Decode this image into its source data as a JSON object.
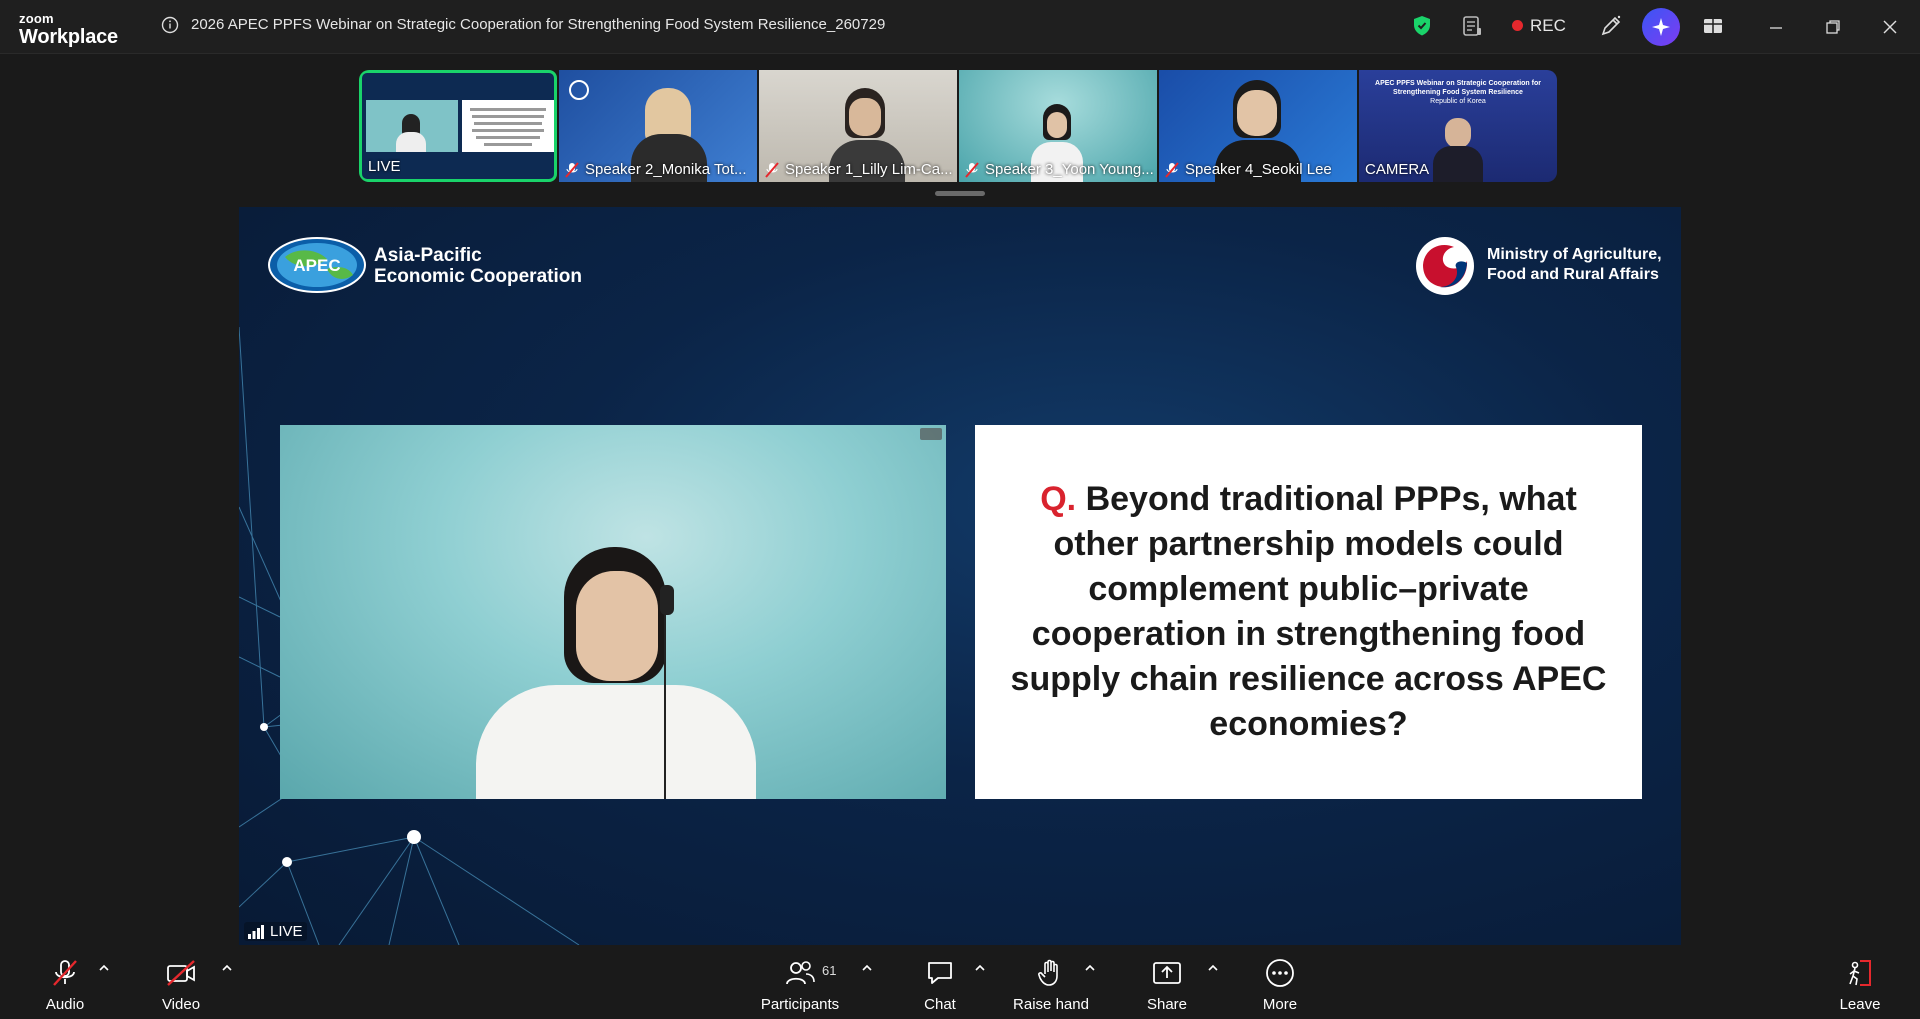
{
  "app": {
    "logo_line1": "zoom",
    "logo_line2": "Workplace",
    "meeting_title": "2026 APEC PPFS Webinar on Strategic Cooperation for Strengthening Food System Resilience_260729",
    "rec_label": "REC"
  },
  "strip": {
    "tiles": [
      {
        "label": "LIVE",
        "muted": false
      },
      {
        "label": "Speaker 2_Monika Tot...",
        "muted": true
      },
      {
        "label": "Speaker 1_Lilly Lim-Ca...",
        "muted": true
      },
      {
        "label": "Speaker 3_Yoon Young...",
        "muted": true
      },
      {
        "label": "Speaker 4_Seokil Lee",
        "muted": true
      },
      {
        "label": "CAMERA",
        "muted": false
      }
    ],
    "tile6_lines": [
      "APEC PPFS Webinar on Strategic Cooperation for",
      "Strengthening Food System Resilience",
      "Republic of Korea"
    ]
  },
  "share": {
    "apec_logo_text": "APEC",
    "apec_line1": "Asia-Pacific",
    "apec_line2": "Economic Cooperation",
    "mafra_line1": "Ministry of Agriculture,",
    "mafra_line2": "Food and Rural Affairs",
    "question_mark": "Q.",
    "question_text": " Beyond traditional PPPs, what other partnership models could complement public–private cooperation in strengthening food supply chain resilience across APEC economies?",
    "live_label": "LIVE"
  },
  "toolbar": {
    "audio": "Audio",
    "video": "Video",
    "participants": "Participants",
    "participants_count": "61",
    "chat": "Chat",
    "raise_hand": "Raise hand",
    "share": "Share",
    "more": "More",
    "leave": "Leave"
  },
  "colors": {
    "accent_green": "#1ad36a",
    "rec_red": "#e5282d",
    "question_red": "#d9232e",
    "slide_bg": "#0b2447"
  }
}
